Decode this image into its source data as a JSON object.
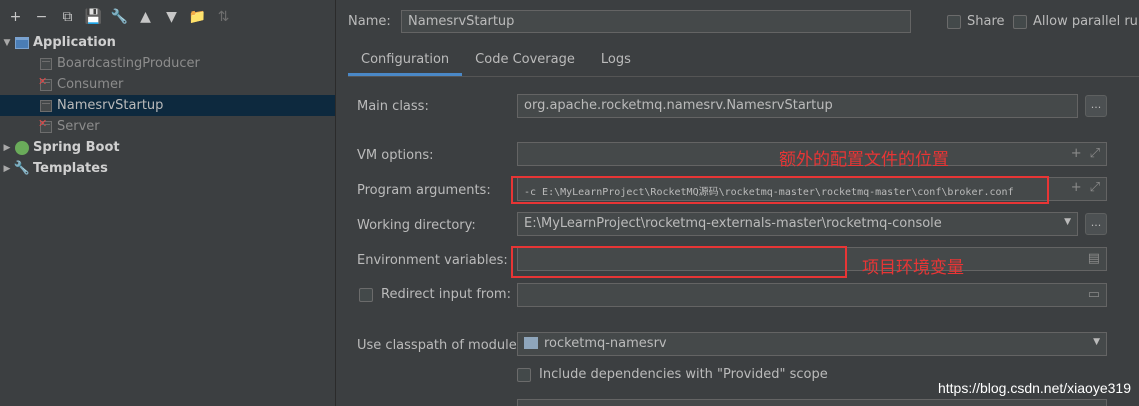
{
  "toolbar": {
    "buttons": [
      "+",
      "−",
      "⧉",
      "💾",
      "🔧",
      "▲",
      "▼",
      "📁",
      "⇅"
    ]
  },
  "tree": {
    "application": "Application",
    "items": [
      "BoardcastingProducer",
      "Consumer",
      "NamesrvStartup",
      "Server"
    ],
    "spring_boot": "Spring Boot",
    "templates": "Templates"
  },
  "header": {
    "name_label": "Name:",
    "name_value": "NamesrvStartup",
    "share_label": "Share",
    "allow_parallel_label": "Allow parallel run"
  },
  "tabs": [
    "Configuration",
    "Code Coverage",
    "Logs"
  ],
  "form": {
    "main_class_label": "Main class:",
    "main_class_value": "org.apache.rocketmq.namesrv.NamesrvStartup",
    "vm_options_label": "VM options:",
    "vm_options_value": "",
    "program_args_label": "Program arguments:",
    "program_args_value": "-c E:\\MyLearnProject\\RocketMQ源码\\rocketmq-master\\rocketmq-master\\conf\\broker.conf",
    "working_dir_label": "Working directory:",
    "working_dir_value": "E:\\MyLearnProject\\rocketmq-externals-master\\rocketmq-console",
    "env_vars_label": "Environment variables:",
    "env_vars_value": "",
    "redirect_label": "Redirect input from:",
    "classpath_label": "Use classpath of module:",
    "classpath_value": "rocketmq-namesrv",
    "include_deps_label": "Include dependencies with \"Provided\" scope",
    "dots": "..."
  },
  "annotations": {
    "config_note": "额外的配置文件的位置",
    "env_note": "项目环境变量"
  },
  "watermark": "https://blog.csdn.net/xiaoye319",
  "colors": {
    "background": "#3c3f41",
    "selection": "#0d293e",
    "accent": "#4a88c7",
    "annotation": "#e83535"
  }
}
